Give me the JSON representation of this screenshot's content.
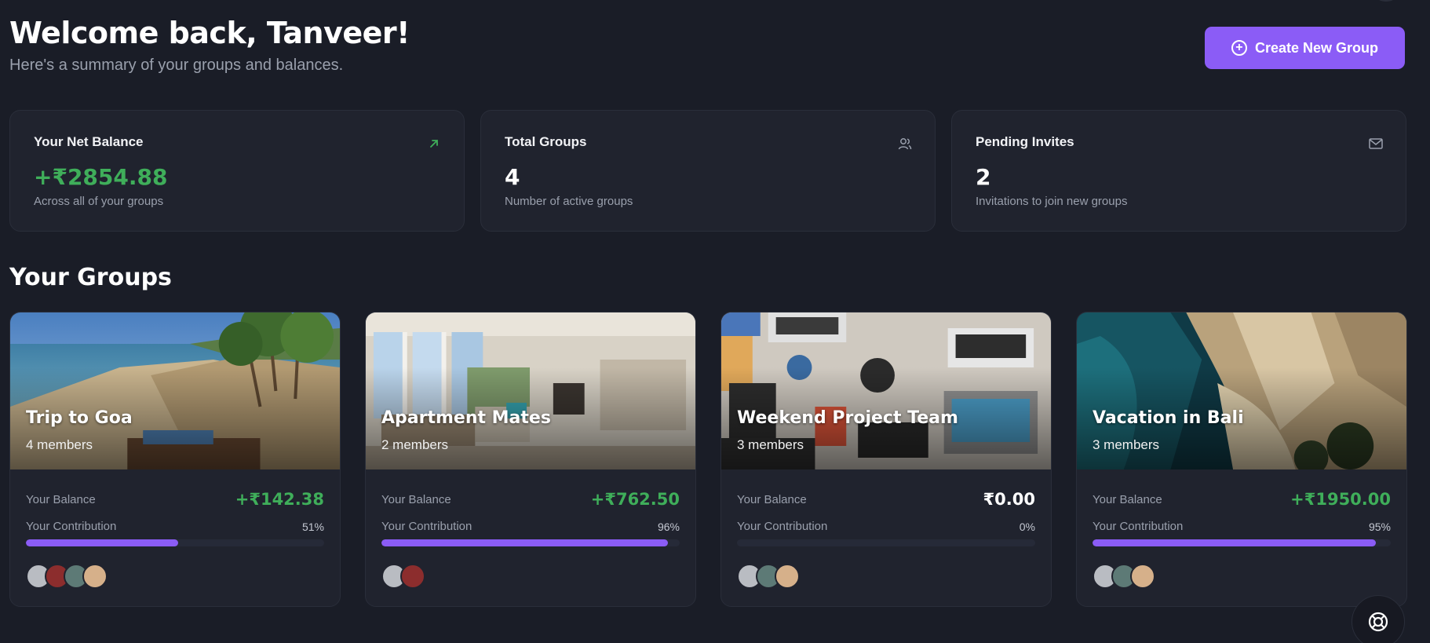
{
  "header": {
    "welcome": "Welcome back, Tanveer!",
    "subtitle": "Here's a summary of your groups and balances.",
    "create_button": "Create New Group"
  },
  "stats": [
    {
      "title": "Your Net Balance",
      "value": "+₹2854.88",
      "desc": "Across all of your groups",
      "icon": "arrow-up-right-icon"
    },
    {
      "title": "Total Groups",
      "value": "4",
      "desc": "Number of active groups",
      "icon": "users-icon"
    },
    {
      "title": "Pending Invites",
      "value": "2",
      "desc": "Invitations to join new groups",
      "icon": "mail-icon"
    }
  ],
  "groups_section": {
    "title": "Your Groups"
  },
  "groups": [
    {
      "name": "Trip to Goa",
      "members": "4 members",
      "balance_label": "Your Balance",
      "balance": "+₹142.38",
      "contribution_label": "Your Contribution",
      "contribution": "51%",
      "contribution_value": 0.51
    },
    {
      "name": "Apartment Mates",
      "members": "2 members",
      "balance_label": "Your Balance",
      "balance": "+₹762.50",
      "contribution_label": "Your Contribution",
      "contribution": "96%",
      "contribution_value": 0.96
    },
    {
      "name": "Weekend Project Team",
      "members": "3 members",
      "balance_label": "Your Balance",
      "balance": "₹0.00",
      "contribution_label": "Your Contribution",
      "contribution": "0%",
      "contribution_value": 0.0
    },
    {
      "name": "Vacation in Bali",
      "members": "3 members",
      "balance_label": "Your Balance",
      "balance": "+₹1950.00",
      "contribution_label": "Your Contribution",
      "contribution": "95%",
      "contribution_value": 0.95
    }
  ],
  "colors": {
    "accent": "#8b5cf6",
    "positive": "#3fae5a",
    "background": "#1a1d27",
    "card": "#20232e"
  },
  "help": {
    "icon": "lifebuoy-icon"
  }
}
